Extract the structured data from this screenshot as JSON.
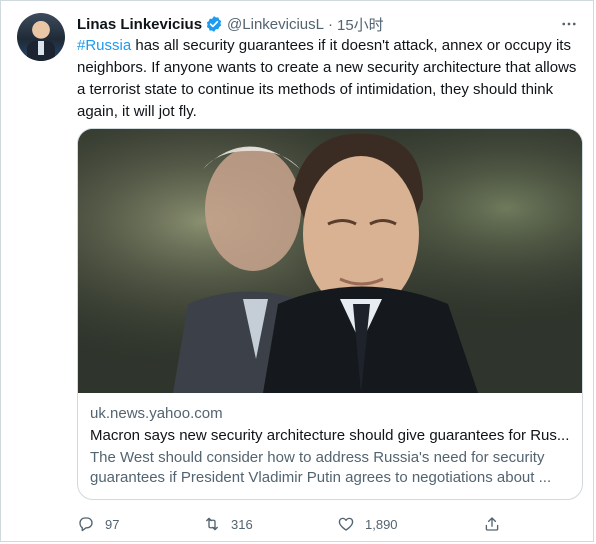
{
  "author": {
    "name": "Linas Linkevicius",
    "handle": "@LinkeviciusL",
    "separator": "·",
    "time": "15小时"
  },
  "tweet": {
    "hashtag": "#Russia",
    "text_rest": " has all security guarantees if it doesn't attack, annex or occupy its neighbors. If anyone wants to create a new security architecture that allows a terrorist state to continue its methods of intimidation, they should think again, it will jot fly."
  },
  "card": {
    "domain": "uk.news.yahoo.com",
    "title": "Macron says new security architecture should give guarantees for Rus...",
    "description": "The West should consider how to address Russia's need for security guarantees if President Vladimir Putin agrees to negotiations about ..."
  },
  "actions": {
    "replies": "97",
    "retweets": "316",
    "likes": "1,890"
  },
  "colors": {
    "accent": "#1d9bf0",
    "secondary_text": "#536471",
    "border": "#cfd9de"
  },
  "icons": [
    "verified-badge-icon",
    "more-icon",
    "reply-icon",
    "retweet-icon",
    "like-icon",
    "share-icon"
  ]
}
